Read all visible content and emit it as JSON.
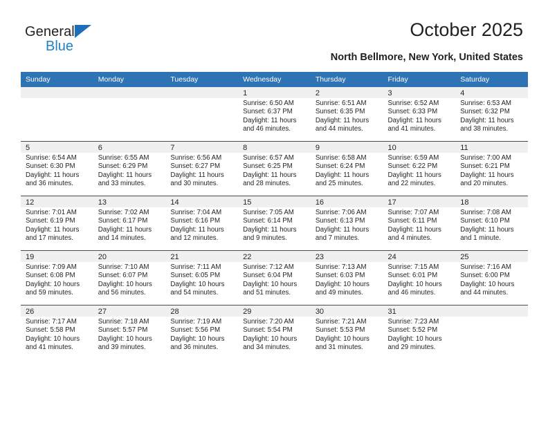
{
  "brand": {
    "line1": "General",
    "line2": "Blue",
    "triangle_color": "#1d70b8",
    "text_color": "#231f20",
    "accent_color": "#1f81c6"
  },
  "header": {
    "title": "October 2025",
    "subtitle": "North Bellmore, New York, United States"
  },
  "theme": {
    "header_row_bg": "#2e74b5",
    "header_row_text": "#ffffff",
    "daynum_bg": "#f0f0f0",
    "row_divider": "#4a4a4a",
    "page_bg": "#ffffff"
  },
  "weekdays": [
    "Sunday",
    "Monday",
    "Tuesday",
    "Wednesday",
    "Thursday",
    "Friday",
    "Saturday"
  ],
  "labels": {
    "sunrise_prefix": "Sunrise:",
    "sunset_prefix": "Sunset:",
    "daylight_prefix": "Daylight:"
  },
  "weeks": [
    [
      {
        "day": "",
        "sunrise": "",
        "sunset": "",
        "daylight": "",
        "blank": true
      },
      {
        "day": "",
        "sunrise": "",
        "sunset": "",
        "daylight": "",
        "blank": true
      },
      {
        "day": "",
        "sunrise": "",
        "sunset": "",
        "daylight": "",
        "blank": true
      },
      {
        "day": "1",
        "sunrise": "Sunrise: 6:50 AM",
        "sunset": "Sunset: 6:37 PM",
        "daylight": "Daylight: 11 hours and 46 minutes."
      },
      {
        "day": "2",
        "sunrise": "Sunrise: 6:51 AM",
        "sunset": "Sunset: 6:35 PM",
        "daylight": "Daylight: 11 hours and 44 minutes."
      },
      {
        "day": "3",
        "sunrise": "Sunrise: 6:52 AM",
        "sunset": "Sunset: 6:33 PM",
        "daylight": "Daylight: 11 hours and 41 minutes."
      },
      {
        "day": "4",
        "sunrise": "Sunrise: 6:53 AM",
        "sunset": "Sunset: 6:32 PM",
        "daylight": "Daylight: 11 hours and 38 minutes."
      }
    ],
    [
      {
        "day": "5",
        "sunrise": "Sunrise: 6:54 AM",
        "sunset": "Sunset: 6:30 PM",
        "daylight": "Daylight: 11 hours and 36 minutes."
      },
      {
        "day": "6",
        "sunrise": "Sunrise: 6:55 AM",
        "sunset": "Sunset: 6:29 PM",
        "daylight": "Daylight: 11 hours and 33 minutes."
      },
      {
        "day": "7",
        "sunrise": "Sunrise: 6:56 AM",
        "sunset": "Sunset: 6:27 PM",
        "daylight": "Daylight: 11 hours and 30 minutes."
      },
      {
        "day": "8",
        "sunrise": "Sunrise: 6:57 AM",
        "sunset": "Sunset: 6:25 PM",
        "daylight": "Daylight: 11 hours and 28 minutes."
      },
      {
        "day": "9",
        "sunrise": "Sunrise: 6:58 AM",
        "sunset": "Sunset: 6:24 PM",
        "daylight": "Daylight: 11 hours and 25 minutes."
      },
      {
        "day": "10",
        "sunrise": "Sunrise: 6:59 AM",
        "sunset": "Sunset: 6:22 PM",
        "daylight": "Daylight: 11 hours and 22 minutes."
      },
      {
        "day": "11",
        "sunrise": "Sunrise: 7:00 AM",
        "sunset": "Sunset: 6:21 PM",
        "daylight": "Daylight: 11 hours and 20 minutes."
      }
    ],
    [
      {
        "day": "12",
        "sunrise": "Sunrise: 7:01 AM",
        "sunset": "Sunset: 6:19 PM",
        "daylight": "Daylight: 11 hours and 17 minutes."
      },
      {
        "day": "13",
        "sunrise": "Sunrise: 7:02 AM",
        "sunset": "Sunset: 6:17 PM",
        "daylight": "Daylight: 11 hours and 14 minutes."
      },
      {
        "day": "14",
        "sunrise": "Sunrise: 7:04 AM",
        "sunset": "Sunset: 6:16 PM",
        "daylight": "Daylight: 11 hours and 12 minutes."
      },
      {
        "day": "15",
        "sunrise": "Sunrise: 7:05 AM",
        "sunset": "Sunset: 6:14 PM",
        "daylight": "Daylight: 11 hours and 9 minutes."
      },
      {
        "day": "16",
        "sunrise": "Sunrise: 7:06 AM",
        "sunset": "Sunset: 6:13 PM",
        "daylight": "Daylight: 11 hours and 7 minutes."
      },
      {
        "day": "17",
        "sunrise": "Sunrise: 7:07 AM",
        "sunset": "Sunset: 6:11 PM",
        "daylight": "Daylight: 11 hours and 4 minutes."
      },
      {
        "day": "18",
        "sunrise": "Sunrise: 7:08 AM",
        "sunset": "Sunset: 6:10 PM",
        "daylight": "Daylight: 11 hours and 1 minute."
      }
    ],
    [
      {
        "day": "19",
        "sunrise": "Sunrise: 7:09 AM",
        "sunset": "Sunset: 6:08 PM",
        "daylight": "Daylight: 10 hours and 59 minutes."
      },
      {
        "day": "20",
        "sunrise": "Sunrise: 7:10 AM",
        "sunset": "Sunset: 6:07 PM",
        "daylight": "Daylight: 10 hours and 56 minutes."
      },
      {
        "day": "21",
        "sunrise": "Sunrise: 7:11 AM",
        "sunset": "Sunset: 6:05 PM",
        "daylight": "Daylight: 10 hours and 54 minutes."
      },
      {
        "day": "22",
        "sunrise": "Sunrise: 7:12 AM",
        "sunset": "Sunset: 6:04 PM",
        "daylight": "Daylight: 10 hours and 51 minutes."
      },
      {
        "day": "23",
        "sunrise": "Sunrise: 7:13 AM",
        "sunset": "Sunset: 6:03 PM",
        "daylight": "Daylight: 10 hours and 49 minutes."
      },
      {
        "day": "24",
        "sunrise": "Sunrise: 7:15 AM",
        "sunset": "Sunset: 6:01 PM",
        "daylight": "Daylight: 10 hours and 46 minutes."
      },
      {
        "day": "25",
        "sunrise": "Sunrise: 7:16 AM",
        "sunset": "Sunset: 6:00 PM",
        "daylight": "Daylight: 10 hours and 44 minutes."
      }
    ],
    [
      {
        "day": "26",
        "sunrise": "Sunrise: 7:17 AM",
        "sunset": "Sunset: 5:58 PM",
        "daylight": "Daylight: 10 hours and 41 minutes."
      },
      {
        "day": "27",
        "sunrise": "Sunrise: 7:18 AM",
        "sunset": "Sunset: 5:57 PM",
        "daylight": "Daylight: 10 hours and 39 minutes."
      },
      {
        "day": "28",
        "sunrise": "Sunrise: 7:19 AM",
        "sunset": "Sunset: 5:56 PM",
        "daylight": "Daylight: 10 hours and 36 minutes."
      },
      {
        "day": "29",
        "sunrise": "Sunrise: 7:20 AM",
        "sunset": "Sunset: 5:54 PM",
        "daylight": "Daylight: 10 hours and 34 minutes."
      },
      {
        "day": "30",
        "sunrise": "Sunrise: 7:21 AM",
        "sunset": "Sunset: 5:53 PM",
        "daylight": "Daylight: 10 hours and 31 minutes."
      },
      {
        "day": "31",
        "sunrise": "Sunrise: 7:23 AM",
        "sunset": "Sunset: 5:52 PM",
        "daylight": "Daylight: 10 hours and 29 minutes."
      },
      {
        "day": "",
        "sunrise": "",
        "sunset": "",
        "daylight": "",
        "blank": true
      }
    ]
  ]
}
